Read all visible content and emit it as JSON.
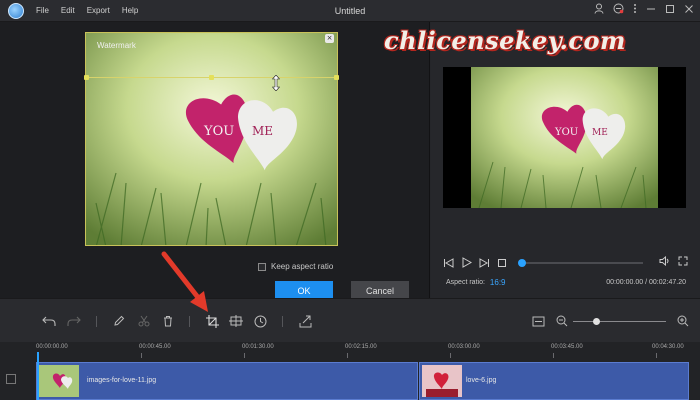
{
  "window": {
    "title": "Untitled",
    "menu": [
      "File",
      "Edit",
      "Export",
      "Help"
    ]
  },
  "editor": {
    "watermark_label": "Watermark",
    "photo_text_left": "YOU",
    "photo_text_right": "ME",
    "keep_aspect_label": "Keep aspect ratio",
    "keep_aspect_checked": false,
    "ok_label": "OK",
    "cancel_label": "Cancel"
  },
  "overlay": {
    "site_text": "chlicensekey.com"
  },
  "preview": {
    "photo_text_left": "YOU",
    "photo_text_right": "ME",
    "aspect_label": "Aspect ratio:",
    "aspect_value": "16:9",
    "time_current": "00:00:00.00",
    "time_total": "00:02:47.20",
    "progress": 0.0
  },
  "toolbar": {
    "zoom_level": 0.25
  },
  "timeline": {
    "ticks": [
      "00:00:00.00",
      "00:00:45.00",
      "00:01:30.00",
      "00:02:15.00",
      "00:03:00.00",
      "00:03:45.00",
      "00:04:30.00"
    ],
    "clips": [
      {
        "name": "images-for-love-11.jpg"
      },
      {
        "name": "love-6.jpg"
      }
    ]
  },
  "colors": {
    "accent": "#1d8ff0",
    "clip": "#3d5aa8",
    "selection": "#c9c25a"
  }
}
